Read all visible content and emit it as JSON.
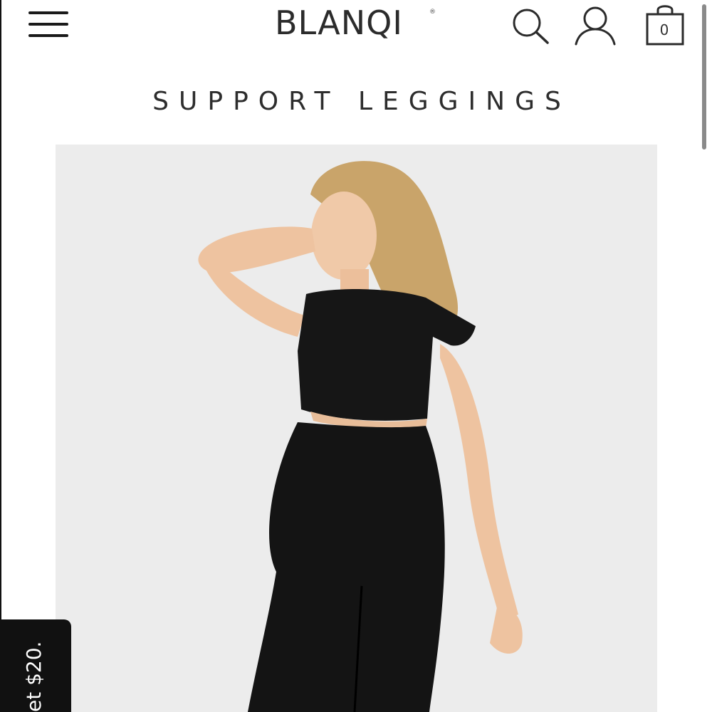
{
  "header": {
    "brand": "BLANQI",
    "brand_mark": "®",
    "menu_icon": "hamburger-menu-icon",
    "search_icon": "search-icon",
    "account_icon": "user-icon",
    "cart_icon": "shopping-bag-icon",
    "cart_count": "0"
  },
  "main": {
    "title": "SUPPORT LEGGINGS",
    "image_background": "#ececec"
  },
  "promo": {
    "text": "et $20."
  },
  "colors": {
    "text": "#2d2d2d",
    "promo_bg": "#111111",
    "promo_text": "#ffffff"
  }
}
